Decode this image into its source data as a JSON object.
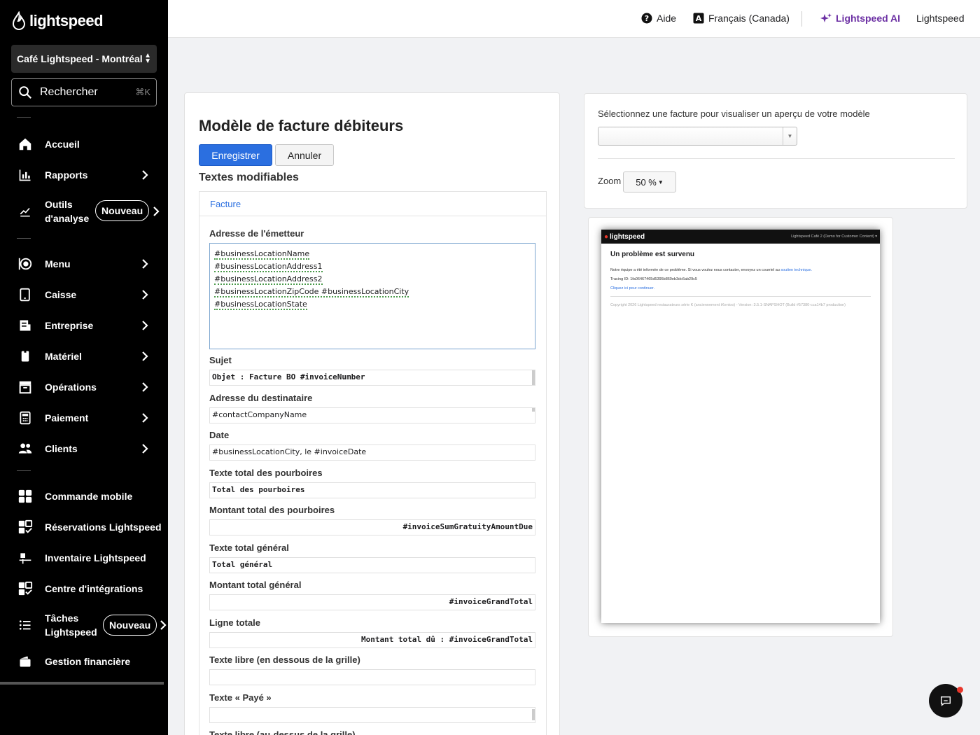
{
  "sidebar": {
    "brand": "lightspeed",
    "location": "Café Lightspeed - Montréal",
    "search_label": "Rechercher",
    "search_shortcut": "⌘K",
    "new_badge": "Nouveau",
    "items": [
      {
        "label": "Accueil"
      },
      {
        "label": "Rapports"
      },
      {
        "label": "Outils d'analyse"
      },
      {
        "label": "Menu"
      },
      {
        "label": "Caisse"
      },
      {
        "label": "Entreprise"
      },
      {
        "label": "Matériel"
      },
      {
        "label": "Opérations"
      },
      {
        "label": "Paiement"
      },
      {
        "label": "Clients"
      },
      {
        "label": "Commande mobile"
      },
      {
        "label": "Réservations Lightspeed"
      },
      {
        "label": "Inventaire Lightspeed"
      },
      {
        "label": "Centre d'intégrations"
      },
      {
        "label": "Tâches Lightspeed"
      },
      {
        "label": "Gestion financière"
      }
    ]
  },
  "topbar": {
    "help": "Aide",
    "language": "Français (Canada)",
    "ai": "Lightspeed AI",
    "account": "Lightspeed",
    "ai_color": "#6b2fa3"
  },
  "main": {
    "title": "Modèle de facture débiteurs",
    "save": "Enregistrer",
    "cancel": "Annuler",
    "section": "Textes modifiables",
    "tab": "Facture",
    "fields": {
      "issuer_label": "Adresse de l'émetteur",
      "issuer_lines": [
        "#businessLocationName",
        "#businessLocationAddress1",
        "#businessLocationAddress2",
        "#businessLocationZipCode #businessLocationCity",
        "#businessLocationState"
      ],
      "subject_label": "Sujet",
      "subject_value": "Objet : Facture BO #invoiceNumber",
      "recipient_label": "Adresse du destinataire",
      "recipient_value": "#contactCompanyName",
      "date_label": "Date",
      "date_value": "#businessLocationCity, le  #invoiceDate",
      "tips_text_label": "Texte total des pourboires",
      "tips_text_value": "Total des pourboires",
      "tips_amount_label": "Montant total des pourboires",
      "tips_amount_value": "#invoiceSumGratuityAmountDue",
      "grand_text_label": "Texte total général",
      "grand_text_value": "Total général",
      "grand_amount_label": "Montant total général",
      "grand_amount_value": "#invoiceGrandTotal",
      "total_line_label": "Ligne totale",
      "total_line_value": "Montant total dû :  #invoiceGrandTotal",
      "free_below_label": "Texte libre (en dessous de la grille)",
      "free_below_value": "",
      "paid_label": "Texte « Payé »",
      "free_above_label": "Texte libre (au-dessus de la grille)"
    }
  },
  "preview": {
    "select_label": "Sélectionnez une facture pour visualiser un aperçu de votre modèle",
    "zoom_label": "Zoom",
    "zoom_value": "50 %",
    "doc": {
      "brand": "lightspeed",
      "account": "Lightspeed Café 2 (Demo for Customer Content) ▾",
      "heading": "Un problème est survenu",
      "text": "Notre équipe a été informée de ce problème. Si vous voulez nous contacter, envoyez un courriel au",
      "support_link": "soutien technique.",
      "tracing": "Tracing ID: 1fa06467465d5395b860eb3dc6ab29c5",
      "continue_link": "Cliquez ici pour continuer.",
      "copyright": "Copyright 2026 Lightspeed restaurateurs série K (anciennement iKentoo) - Version: 3.5.1-SNAPSHOT (Build #57380-cca14b7 production)"
    }
  },
  "colors": {
    "primary": "#2b6fe0",
    "sidebar_bg": "#000000",
    "notification": "#e8372b"
  }
}
